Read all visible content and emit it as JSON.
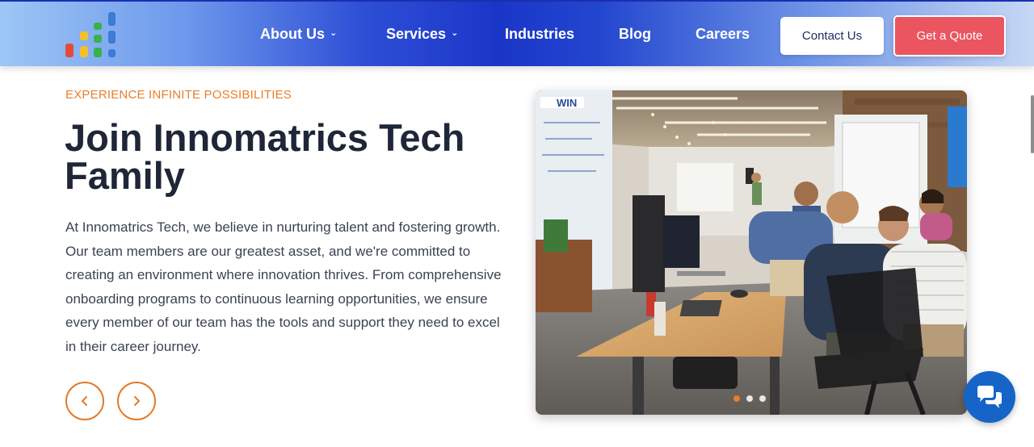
{
  "header": {
    "logo_name": "bar-chart-logo",
    "nav": [
      {
        "label": "About Us",
        "has_dropdown": true
      },
      {
        "label": "Services",
        "has_dropdown": true
      },
      {
        "label": "Industries",
        "has_dropdown": false
      },
      {
        "label": "Blog",
        "has_dropdown": false
      },
      {
        "label": "Careers",
        "has_dropdown": false
      }
    ],
    "contact_label": "Contact Us",
    "quote_label": "Get a Quote"
  },
  "hero": {
    "eyebrow": "EXPERIENCE INFINITE POSSIBILITIES",
    "title": "Join Innomatrics Tech Family",
    "description": "At Innomatrics Tech, we believe in nurturing talent and fostering growth. Our team members are our greatest asset, and we're committed to creating an environment where innovation thrives. From comprehensive onboarding programs to continuous learning opportunities, we ensure every member of our team has the tools and support they need to excel in their career journey.",
    "prev_icon": "chevron-left-icon",
    "next_icon": "chevron-right-icon"
  },
  "carousel": {
    "sign_text": "WIN",
    "slide_count": 3,
    "active_slide": 1
  },
  "colors": {
    "accent": "#e87e2a",
    "quote_button": "#ea5560",
    "chat_button": "#1664c8",
    "heading": "#1e2638"
  },
  "chat": {
    "icon": "chat-bubbles-icon"
  }
}
